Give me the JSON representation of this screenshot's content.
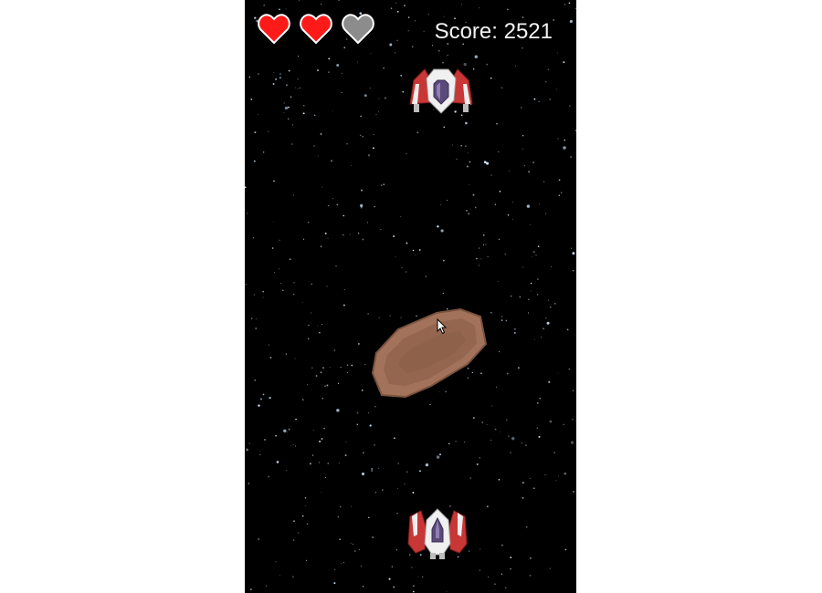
{
  "hud": {
    "lives": [
      {
        "state": "full",
        "color": "#ff1a1a"
      },
      {
        "state": "full",
        "color": "#ff1a1a"
      },
      {
        "state": "empty",
        "color": "#8c8c8c"
      }
    ],
    "lives_remaining": 2,
    "lives_max": 3,
    "score_text": "Score: 2521"
  },
  "colors": {
    "background": "#000000",
    "star": "#cfe9ff",
    "ship_red": "#c93636",
    "ship_white": "#f0f0f0",
    "cockpit": "#5a4a7a",
    "asteroid": "#a2735a"
  },
  "entities": {
    "enemy": {
      "icon": "enemy-ship-icon"
    },
    "asteroid": {
      "icon": "asteroid-icon"
    },
    "player": {
      "icon": "player-ship-icon"
    },
    "cursor": {
      "icon": "mouse-cursor-icon"
    }
  }
}
